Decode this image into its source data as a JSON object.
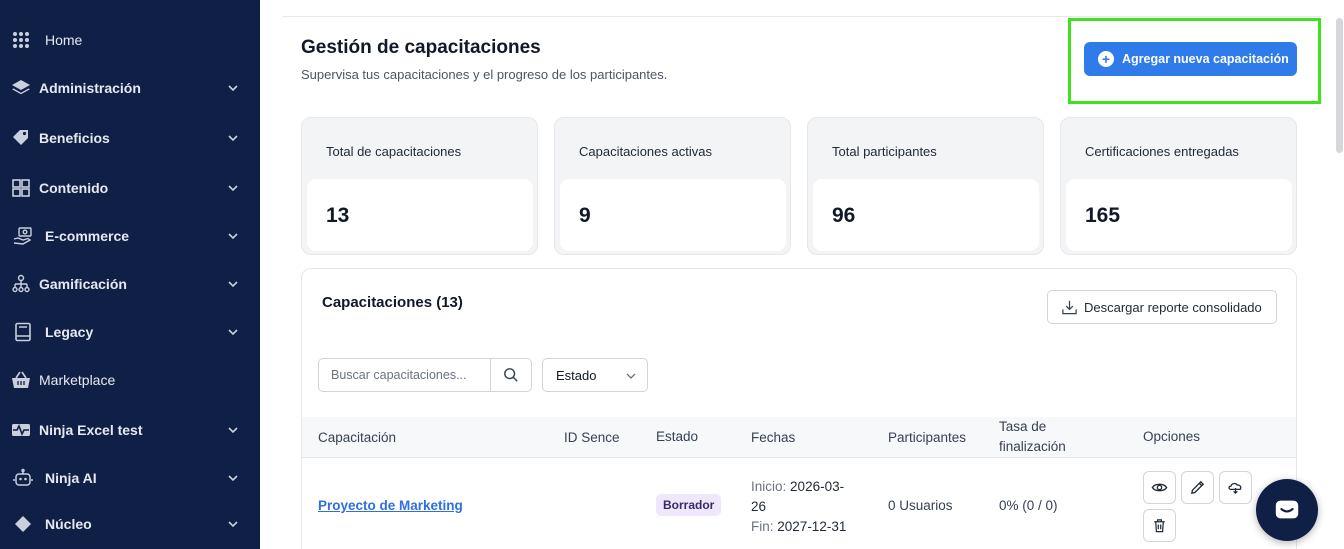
{
  "sidebar": {
    "items": [
      {
        "label": "Home",
        "icon": "grid-icon",
        "has_chevron": false
      },
      {
        "label": "Administración",
        "icon": "layers-icon",
        "has_chevron": true
      },
      {
        "label": "Beneficios",
        "icon": "tag-icon",
        "has_chevron": true
      },
      {
        "label": "Contenido",
        "icon": "layout-icon",
        "has_chevron": true
      },
      {
        "label": "E-commerce",
        "icon": "hand-money-icon",
        "has_chevron": true
      },
      {
        "label": "Gamificación",
        "icon": "hierarchy-icon",
        "has_chevron": true
      },
      {
        "label": "Legacy",
        "icon": "book-icon",
        "has_chevron": true
      },
      {
        "label": "Marketplace",
        "icon": "basket-icon",
        "has_chevron": false
      },
      {
        "label": "Ninja Excel test",
        "icon": "pulse-icon",
        "has_chevron": true
      },
      {
        "label": "Ninja AI",
        "icon": "robot-icon",
        "has_chevron": true
      },
      {
        "label": "Núcleo",
        "icon": "diamond-icon",
        "has_chevron": true
      }
    ]
  },
  "header": {
    "title": "Gestión de capacitaciones",
    "subtitle": "Supervisa tus capacitaciones y el progreso de los participantes.",
    "add_button_label": "Agregar nueva capacitación"
  },
  "stats": [
    {
      "label": "Total de capacitaciones",
      "value": "13"
    },
    {
      "label": "Capacitaciones activas",
      "value": "9"
    },
    {
      "label": "Total participantes",
      "value": "96"
    },
    {
      "label": "Certificaciones entregadas",
      "value": "165"
    }
  ],
  "table": {
    "title": "Capacitaciones (13)",
    "download_label": "Descargar reporte consolidado",
    "search_placeholder": "Buscar capacitaciones...",
    "status_filter": "Estado",
    "headers": {
      "course": "Capacitación",
      "sence": "ID Sence",
      "status": "Estado",
      "dates": "Fechas",
      "participants": "Participantes",
      "rate_line1": "Tasa de",
      "rate_line2": "finalización",
      "options": "Opciones"
    },
    "rows": [
      {
        "course": "Proyecto de Marketing",
        "sence": "",
        "status": "Borrador",
        "start_label": "Inicio:",
        "start_value_a": "2026-03-",
        "start_value_b": "26",
        "end_label": "Fin:",
        "end_value": "2027-12-31",
        "participants": "0 Usuarios",
        "rate": "0% (0 / 0)"
      }
    ]
  },
  "colors": {
    "sidebar_bg": "#101f45",
    "primary": "#2f7bea",
    "highlight": "#3ee21d",
    "badge_bg": "#efe7fb"
  }
}
